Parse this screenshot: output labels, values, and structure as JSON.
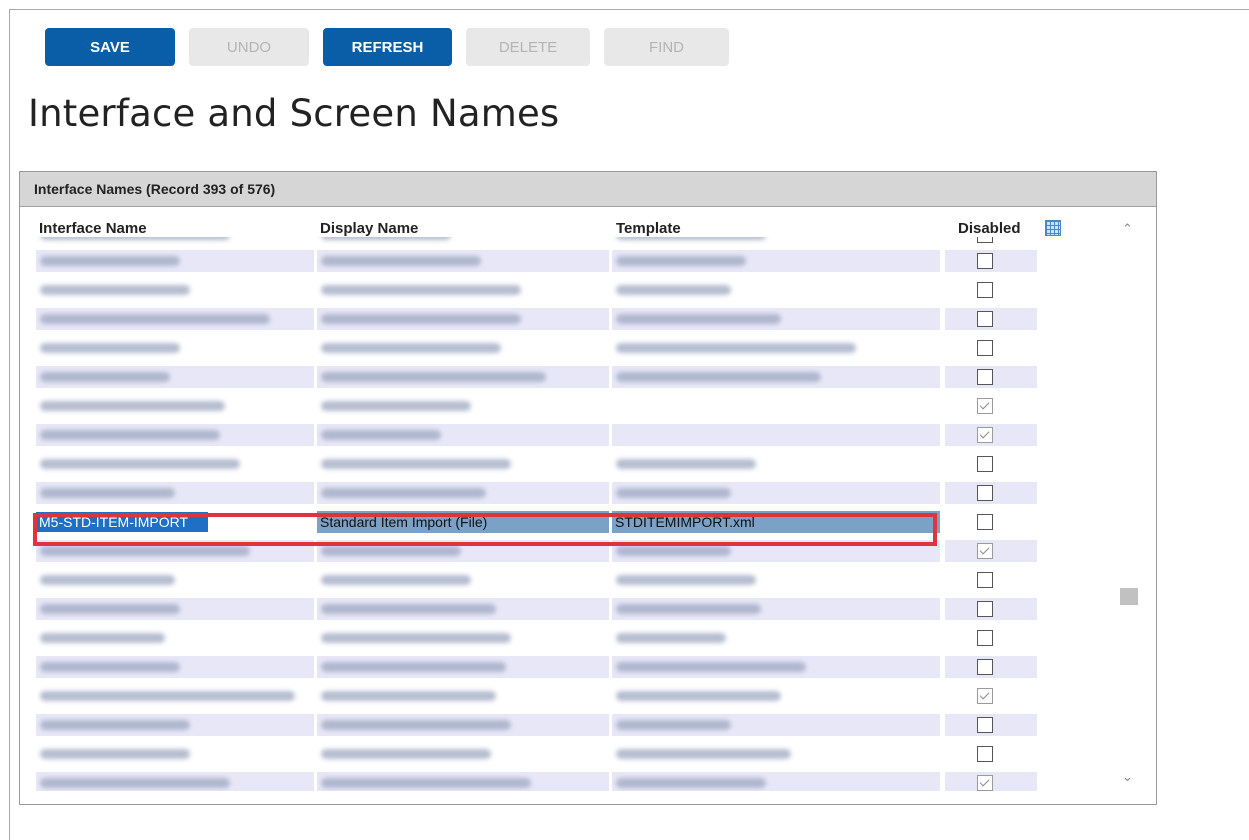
{
  "toolbar": {
    "save_label": "SAVE",
    "undo_label": "UNDO",
    "refresh_label": "REFRESH",
    "delete_label": "DELETE",
    "find_label": "FIND"
  },
  "page_title": "Interface and Screen Names",
  "panel": {
    "header": "Interface Names (Record 393 of 576)",
    "columns": {
      "interface_name": "Interface Name",
      "display_name": "Display Name",
      "template": "Template",
      "disabled": "Disabled"
    },
    "grid_icon": "grid-icon"
  },
  "rows": [
    {
      "disabled": false,
      "partial": true
    },
    {
      "disabled": false
    },
    {
      "disabled": false
    },
    {
      "disabled": false
    },
    {
      "disabled": false
    },
    {
      "disabled": false
    },
    {
      "disabled": true
    },
    {
      "disabled": true
    },
    {
      "disabled": false
    },
    {
      "disabled": false
    },
    {
      "selected": true,
      "interface_name": "M5-STD-ITEM-IMPORT",
      "display_name": "Standard Item Import (File)",
      "template": "STDITEMIMPORT.xml",
      "disabled": false
    },
    {
      "disabled": true
    },
    {
      "disabled": false
    },
    {
      "disabled": false
    },
    {
      "disabled": false
    },
    {
      "disabled": false
    },
    {
      "disabled": true
    },
    {
      "disabled": false
    },
    {
      "disabled": false
    },
    {
      "disabled": true,
      "partial": true
    }
  ],
  "colors": {
    "primary_button": "#0a5ea8",
    "highlight_border": "#e0343c",
    "row_shade": "#e7e7f7",
    "selection": "#1f6fc4"
  }
}
